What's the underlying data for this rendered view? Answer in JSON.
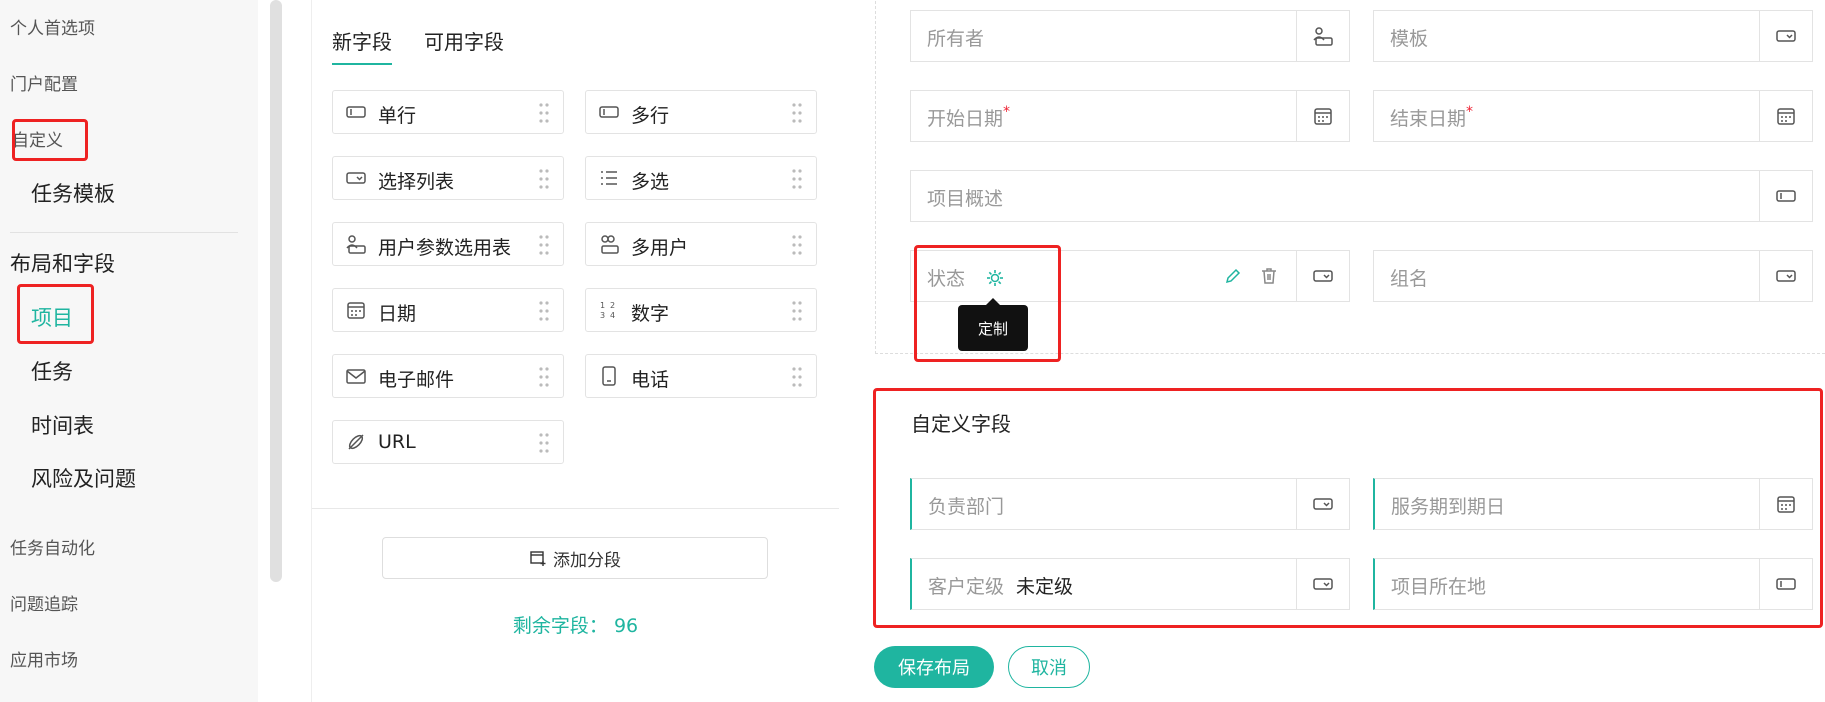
{
  "sidebar": {
    "items": [
      {
        "label": "个人首选项"
      },
      {
        "label": "门户配置"
      },
      {
        "label": "自定义"
      },
      {
        "label": "任务模板"
      },
      {
        "label": "布局和字段"
      },
      {
        "label": "项目"
      },
      {
        "label": "任务"
      },
      {
        "label": "时间表"
      },
      {
        "label": "风险及问题"
      },
      {
        "label": "任务自动化"
      },
      {
        "label": "问题追踪"
      },
      {
        "label": "应用市场"
      }
    ]
  },
  "field_panel": {
    "tabs": [
      {
        "label": "新字段",
        "active": true
      },
      {
        "label": "可用字段",
        "active": false
      }
    ],
    "fields": [
      {
        "label": "单行",
        "icon": "single-line-icon"
      },
      {
        "label": "多行",
        "icon": "multi-line-icon"
      },
      {
        "label": "选择列表",
        "icon": "picklist-icon"
      },
      {
        "label": "多选",
        "icon": "multi-select-icon"
      },
      {
        "label": "用户参数选用表",
        "icon": "user-picklist-icon"
      },
      {
        "label": "多用户",
        "icon": "multi-user-icon"
      },
      {
        "label": "日期",
        "icon": "calendar-icon"
      },
      {
        "label": "数字",
        "icon": "number-icon"
      },
      {
        "label": "电子邮件",
        "icon": "email-icon"
      },
      {
        "label": "电话",
        "icon": "phone-icon"
      },
      {
        "label": "URL",
        "icon": "link-icon"
      }
    ],
    "add_section_label": "添加分段",
    "remaining_label": "剩余字段：",
    "remaining_count": "96"
  },
  "layout": {
    "fields": {
      "owner": {
        "label": "所有者"
      },
      "template": {
        "label": "模板"
      },
      "start_date": {
        "label": "开始日期",
        "required_mark": "*"
      },
      "end_date": {
        "label": "结束日期",
        "required_mark": "*"
      },
      "summary": {
        "label": "项目概述"
      },
      "status": {
        "label": "状态"
      },
      "group": {
        "label": "组名"
      }
    },
    "tooltip": "定制",
    "custom_section_title": "自定义字段",
    "custom_fields": {
      "department": {
        "label": "负责部门"
      },
      "service_expiry": {
        "label": "服务期到期日"
      },
      "customer_rating": {
        "label": "客户定级",
        "value": "未定级"
      },
      "location": {
        "label": "项目所在地"
      }
    },
    "save_label": "保存布局",
    "cancel_label": "取消"
  },
  "colors": {
    "accent": "#1fb5a0",
    "highlight": "#ee2222",
    "required": "#ee2233"
  }
}
